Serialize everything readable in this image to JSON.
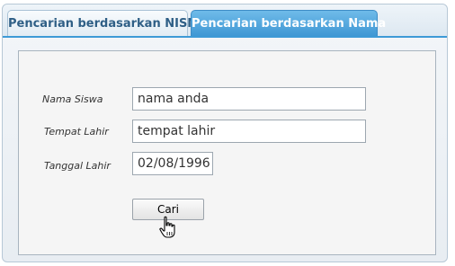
{
  "tabs": [
    {
      "label": "Pencarian berdasarkan NISN",
      "active": false
    },
    {
      "label": "Pencarian berdasarkan Nama",
      "active": true
    }
  ],
  "form": {
    "nama_siswa": {
      "label": "Nama Siswa",
      "value": "nama anda"
    },
    "tempat_lahir": {
      "label": "Tempat Lahir",
      "value": "tempat lahir"
    },
    "tanggal_lahir": {
      "label": "Tanggal Lahir",
      "value": "02/08/1996"
    },
    "submit_label": "Cari"
  },
  "colors": {
    "active_tab": "#3f97d4",
    "inactive_tab_text": "#2f5f86",
    "tab_bar_underline": "#3d9ad6"
  },
  "icons": {
    "pointer": "hand-pointer-cursor"
  }
}
